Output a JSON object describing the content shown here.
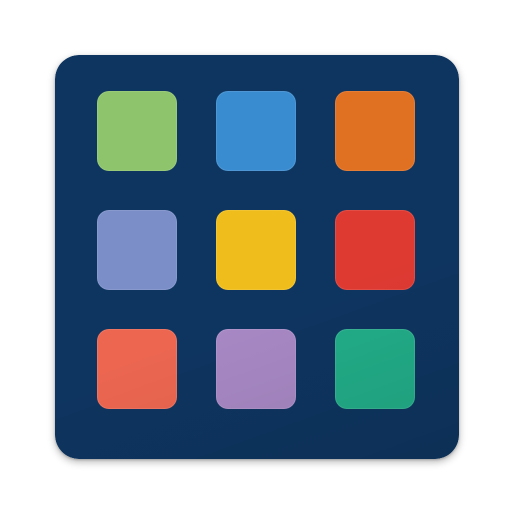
{
  "icon": {
    "name": "app-icon",
    "background_color": "#0e3560"
  },
  "tiles": [
    {
      "name": "tile-green",
      "color": "#8ec46b"
    },
    {
      "name": "tile-blue",
      "color": "#3a8cd0"
    },
    {
      "name": "tile-orange",
      "color": "#e07022"
    },
    {
      "name": "tile-periwinkle",
      "color": "#7b8ec8"
    },
    {
      "name": "tile-yellow",
      "color": "#f0be1c"
    },
    {
      "name": "tile-red",
      "color": "#de3a32"
    },
    {
      "name": "tile-coral",
      "color": "#ec6650"
    },
    {
      "name": "tile-lavender",
      "color": "#a888c4"
    },
    {
      "name": "tile-teal",
      "color": "#22ad88"
    }
  ]
}
